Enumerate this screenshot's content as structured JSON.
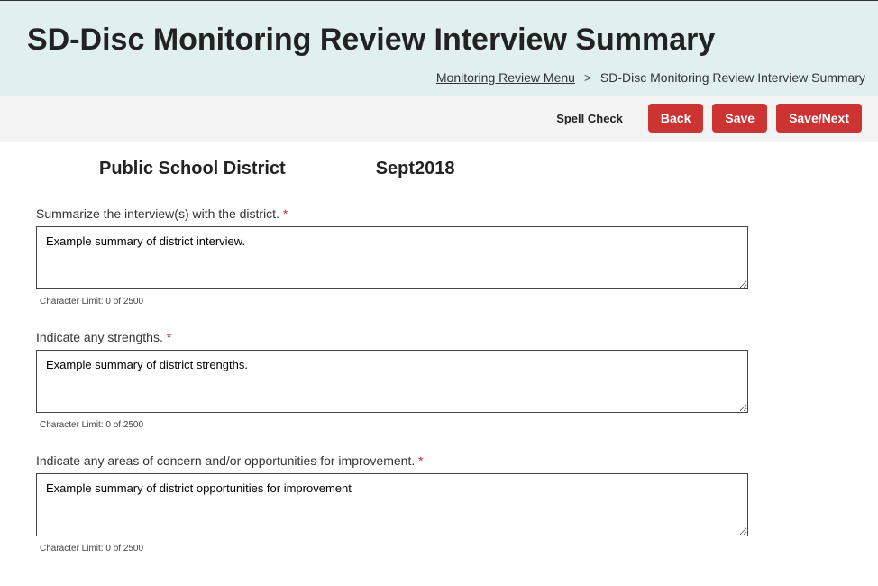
{
  "header": {
    "title": "SD-Disc Monitoring Review Interview Summary"
  },
  "breadcrumb": {
    "link_label": "Monitoring Review Menu",
    "separator": ">",
    "current": "SD-Disc Monitoring Review Interview Summary"
  },
  "toolbar": {
    "spell_check_label": "Spell Check",
    "back_label": "Back",
    "save_label": "Save",
    "save_next_label": "Save/Next"
  },
  "meta": {
    "district": "Public School District",
    "period": "Sept2018"
  },
  "fields": {
    "summary": {
      "label": "Summarize the interview(s) with the district.",
      "required_marker": "*",
      "value": "Example summary of district interview.",
      "char_limit_text": "Character Limit: 0 of 2500"
    },
    "strengths": {
      "label": "Indicate any strengths.",
      "required_marker": "*",
      "value": "Example summary of district strengths.",
      "char_limit_text": "Character Limit: 0 of 2500"
    },
    "concerns": {
      "label": "Indicate any areas of concern and/or opportunities for improvement.",
      "required_marker": "*",
      "value": "Example summary of district opportunities for improvement",
      "char_limit_text": "Character Limit: 0 of 2500"
    }
  }
}
